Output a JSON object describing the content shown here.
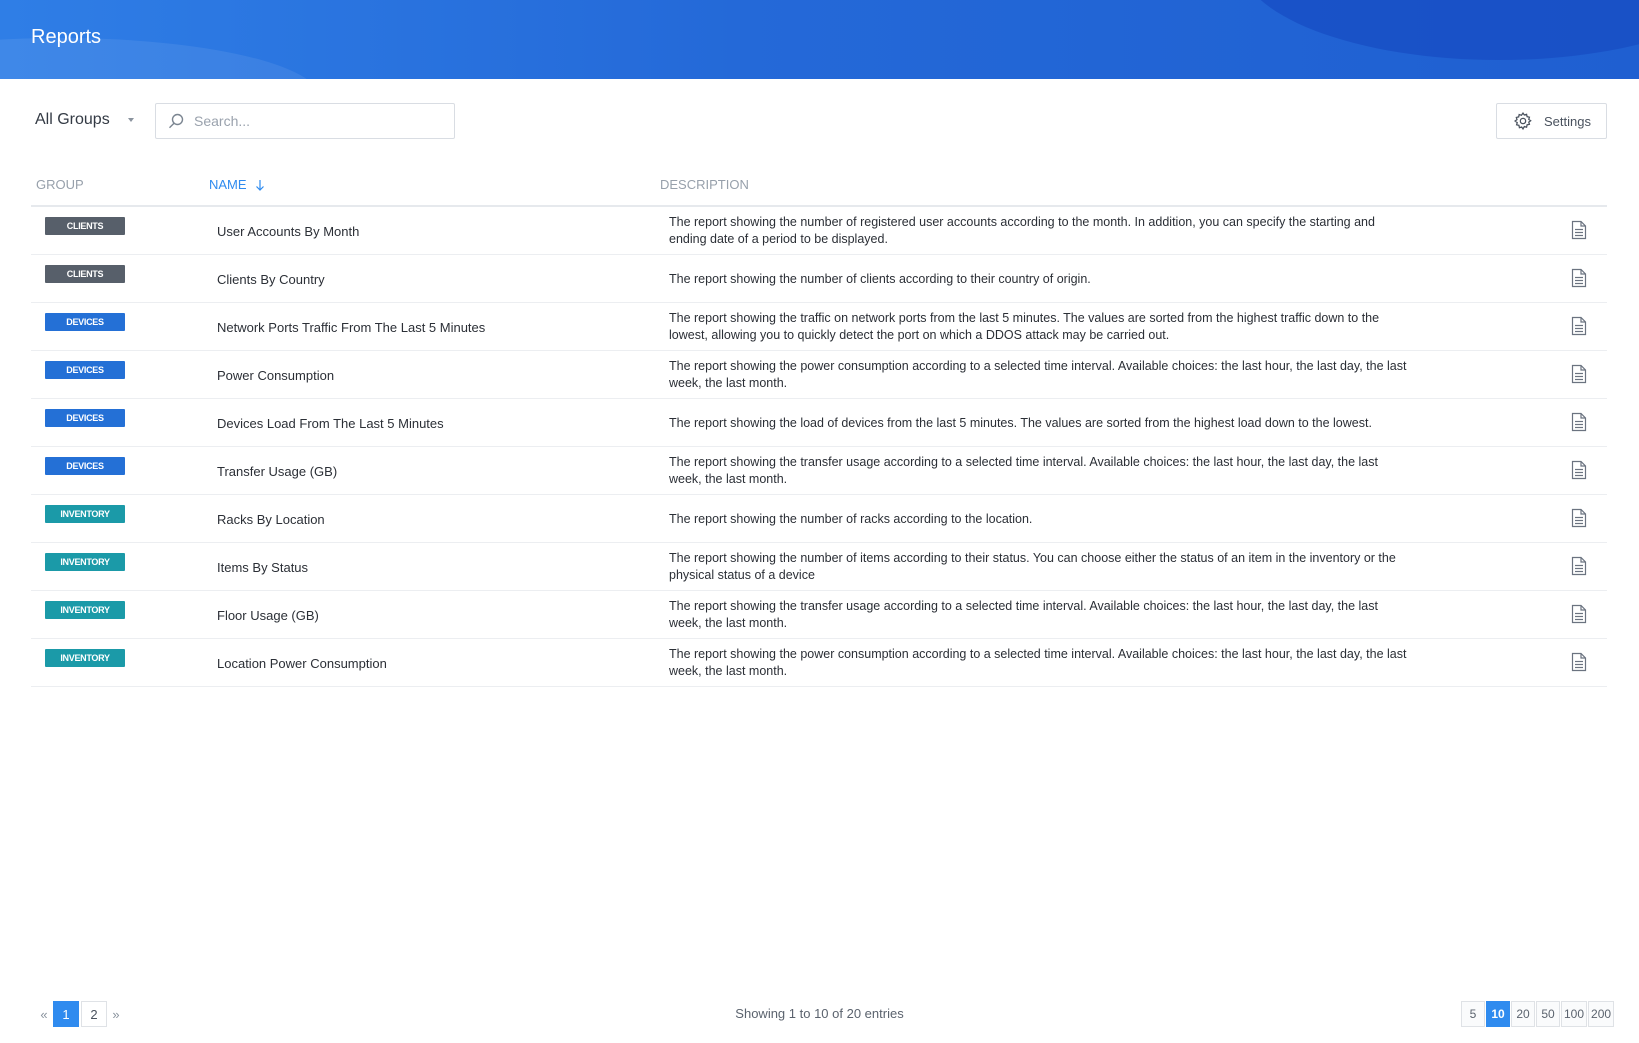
{
  "header": {
    "title": "Reports"
  },
  "toolbar": {
    "group_filter": "All Groups",
    "search_placeholder": "Search...",
    "settings_label": "Settings"
  },
  "table": {
    "columns": {
      "group": "GROUP",
      "name": "NAME",
      "description": "DESCRIPTION"
    },
    "sort": {
      "column": "name",
      "direction": "descending"
    },
    "rows": [
      {
        "group": "CLIENTS",
        "group_class": "clients",
        "name": "User Accounts By Month",
        "description": "The report showing the number of registered user accounts according to the month. In addition, you can specify the starting and ending date of a period to be displayed."
      },
      {
        "group": "CLIENTS",
        "group_class": "clients",
        "name": "Clients By Country",
        "description": "The report showing the number of clients according to their country of origin."
      },
      {
        "group": "DEVICES",
        "group_class": "devices",
        "name": "Network Ports Traffic From The Last 5 Minutes",
        "description": "The report showing the traffic on network ports from the last 5 minutes. The values are sorted from the highest traffic down to the lowest, allowing you to quickly detect the port on which a DDOS attack may be carried out."
      },
      {
        "group": "DEVICES",
        "group_class": "devices",
        "name": "Power Consumption",
        "description": "The report showing the power consumption according to a selected time interval. Available choices: the last hour, the last day, the last week, the last month."
      },
      {
        "group": "DEVICES",
        "group_class": "devices",
        "name": "Devices Load From The Last 5 Minutes",
        "description": "The report showing the load of devices from the last 5 minutes. The values are sorted from the highest load down to the lowest."
      },
      {
        "group": "DEVICES",
        "group_class": "devices",
        "name": "Transfer Usage (GB)",
        "description": "The report showing the transfer usage according to a selected time interval. Available choices: the last hour, the last day, the last week, the last month."
      },
      {
        "group": "INVENTORY",
        "group_class": "inventory",
        "name": "Racks By Location",
        "description": "The report showing the number of racks according to the location."
      },
      {
        "group": "INVENTORY",
        "group_class": "inventory",
        "name": "Items By Status",
        "description": "The report showing the number of items according to their status. You can choose either the status of an item in the inventory or the physical status of a device"
      },
      {
        "group": "INVENTORY",
        "group_class": "inventory",
        "name": "Floor Usage (GB)",
        "description": "The report showing the transfer usage according to a selected time interval. Available choices: the last hour, the last day, the last week, the last month."
      },
      {
        "group": "INVENTORY",
        "group_class": "inventory",
        "name": "Location Power Consumption",
        "description": "The report showing the power consumption according to a selected time interval. Available choices: the last hour, the last day, the last week, the last month."
      }
    ]
  },
  "pagination": {
    "pages": [
      "1",
      "2"
    ],
    "current_page": "1",
    "entries_text": "Showing 1 to 10 of 20 entries",
    "page_sizes": [
      "5",
      "10",
      "20",
      "50",
      "100",
      "200"
    ],
    "current_page_size": "10"
  },
  "colors": {
    "header": "#2469d8",
    "accent": "#2f8bef",
    "clients_badge": "#575f6a",
    "devices_badge": "#2470d6",
    "inventory_badge": "#1b9aa8"
  },
  "icons": {
    "search": "search-icon",
    "settings": "gear-icon",
    "sort": "arrow-down-icon",
    "report": "document-icon",
    "prev": "double-chevron-left-icon",
    "next": "double-chevron-right-icon"
  }
}
